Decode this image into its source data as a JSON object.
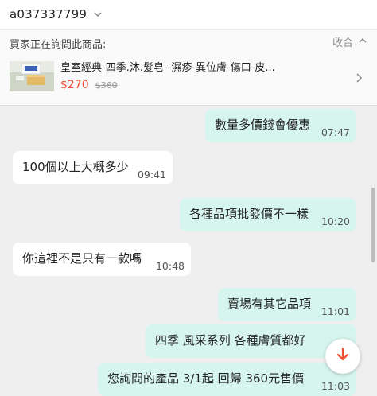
{
  "header": {
    "username": "a037337799",
    "chevron_icon": "chevron-down-icon"
  },
  "product_card": {
    "inquiry_label": "買家正在詢問此商品:",
    "collapse_label": "收合",
    "product_name": "皇室經典-四季.沐.髮皂--濕疹-異位膚-傷口-皮...",
    "price": "$270",
    "original_price": "$360"
  },
  "messages": [
    {
      "side": "out",
      "text": "數量多價錢會優惠",
      "time": "07:47"
    },
    {
      "side": "in",
      "text": "100個以上大概多少",
      "time": "09:41"
    },
    {
      "side": "out",
      "text": "各種品項批發價不一樣",
      "time": "10:20"
    },
    {
      "side": "in",
      "text": "你這裡不是只有一款嗎",
      "time": "10:48"
    },
    {
      "side": "out",
      "text": "賣場有其它品項",
      "time": "11:01"
    },
    {
      "side": "out",
      "text": "四季  風采系列 各種膚質都好",
      "time": "1"
    },
    {
      "side": "out",
      "text": "您詢問的產品  3/1起  回歸 360元售價",
      "time": "11:03"
    }
  ],
  "scroll_button": {
    "icon": "arrow-down-icon",
    "color": "#ee4d2d"
  },
  "colors": {
    "accent": "#ee4d2d",
    "outgoing_bubble": "#d7f5ef",
    "incoming_bubble": "#ffffff",
    "chat_background": "#efefef"
  }
}
